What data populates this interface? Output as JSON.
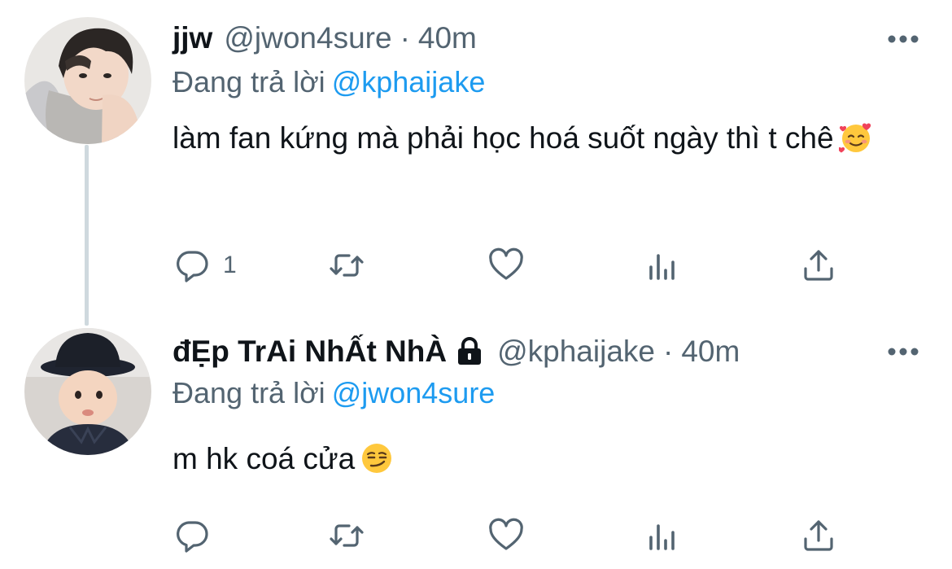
{
  "colors": {
    "text": "#0f1419",
    "secondary": "#536471",
    "accent": "#1d9bf0",
    "thread_line": "#cfd9de"
  },
  "tweets": [
    {
      "display_name": "jjw",
      "handle": "@jwon4sure",
      "separator": "·",
      "time": "40m",
      "protected": false,
      "replying_label": "Đang trả lời",
      "replying_to": "@kphaijake",
      "text": "làm fan kứng mà phải học hoá suốt ngày thì t chê",
      "emoji": "smiling-face-with-hearts",
      "reply_count": "1",
      "actions": [
        "reply-icon",
        "retweet-icon",
        "like-icon",
        "views-icon",
        "share-icon"
      ]
    },
    {
      "display_name": "đẸp TrAi NhẤt NhÀ",
      "handle": "@kphaijake",
      "separator": "·",
      "time": "40m",
      "protected": true,
      "replying_label": "Đang trả lời",
      "replying_to": "@jwon4sure",
      "text": "m hk coá cửa",
      "emoji": "smirking-face",
      "reply_count": "",
      "actions": [
        "reply-icon",
        "retweet-icon",
        "like-icon",
        "views-icon",
        "share-icon"
      ]
    }
  ]
}
